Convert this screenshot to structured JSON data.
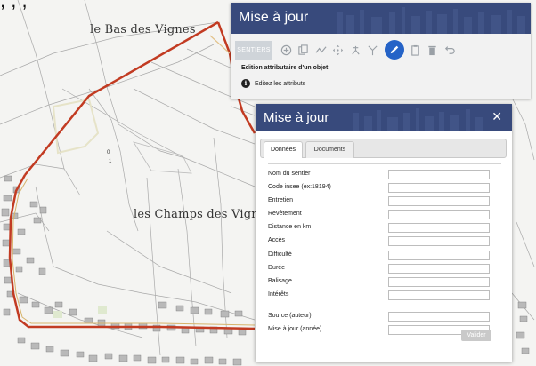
{
  "map": {
    "top_clipped_text": ", , ,",
    "place_labels": {
      "bas_des_vignes": "le Bas des Vignes",
      "champs_des_vignes": "les Champs des Vignes"
    },
    "colors": {
      "route": "#c23b22",
      "parcel_line": "#a7a7a7",
      "background": "#f4f4f2",
      "building": "#b9b9b9"
    }
  },
  "top_panel": {
    "title": "Mise à jour",
    "layer_button": "SENTIERS",
    "tools": [
      "add-circle-icon",
      "copy-icon",
      "line-icon",
      "move-icon",
      "split-icon",
      "merge-icon",
      "pencil-icon",
      "clipboard-icon",
      "trash-icon",
      "undo-icon"
    ],
    "active_tool": "pencil-icon",
    "heading": "Edition attributaire d'un objet",
    "info_text": "Editez les attributs"
  },
  "dialog": {
    "title": "Mise à jour",
    "close_glyph": "✕",
    "tabs": [
      {
        "label": "Données",
        "active": true
      },
      {
        "label": "Documents",
        "active": false
      }
    ],
    "fields": [
      {
        "label": "Nom du sentier",
        "value": ""
      },
      {
        "label": "Code insee (ex:18194)",
        "value": ""
      },
      {
        "label": "Entretien",
        "value": ""
      },
      {
        "label": "Revêtement",
        "value": ""
      },
      {
        "label": "Distance en km",
        "value": ""
      },
      {
        "label": "Accès",
        "value": ""
      },
      {
        "label": "Difficulté",
        "value": ""
      },
      {
        "label": "Durée",
        "value": ""
      },
      {
        "label": "Balisage",
        "value": ""
      },
      {
        "label": "Intérêts",
        "value": ""
      }
    ],
    "meta_fields": [
      {
        "label": "Source (auteur)",
        "value": ""
      },
      {
        "label": "Mise à jour (année)",
        "value": ""
      }
    ],
    "submit_label": "Valider"
  },
  "theme": {
    "banner_color": "#384a7c",
    "active_tool_color": "#2563c7"
  }
}
